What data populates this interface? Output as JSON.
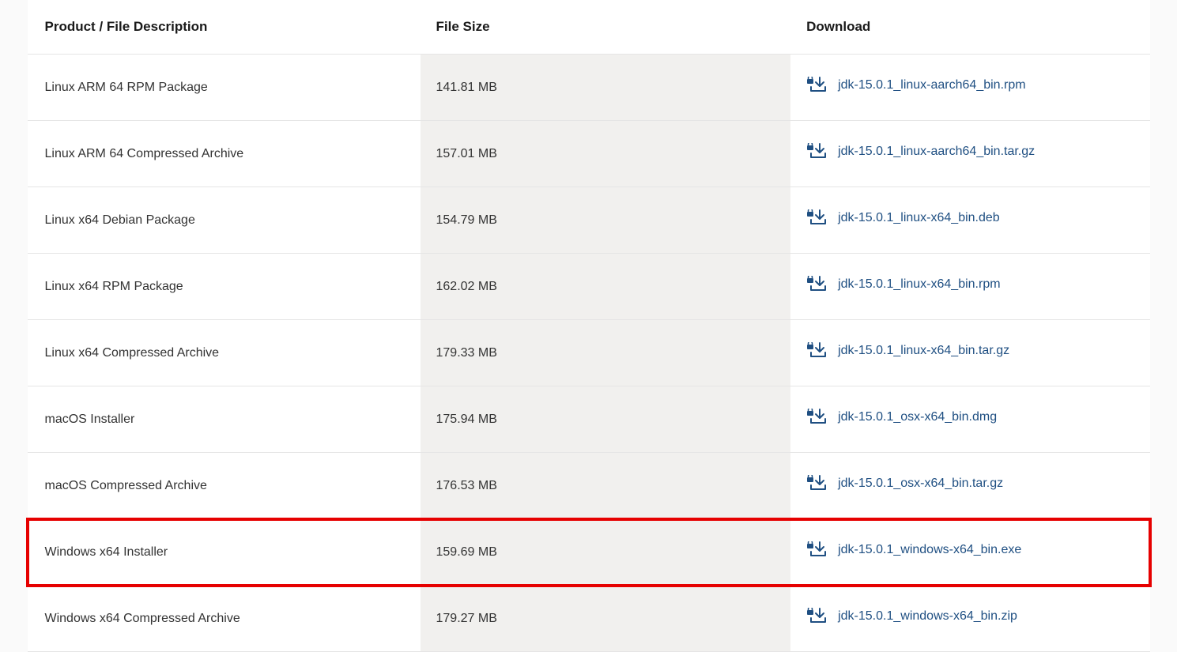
{
  "headers": {
    "product": "Product / File Description",
    "size": "File Size",
    "download": "Download"
  },
  "rows": [
    {
      "product": "Linux ARM 64 RPM Package",
      "size": "141.81 MB",
      "file": "jdk-15.0.1_linux-aarch64_bin.rpm",
      "highlighted": false
    },
    {
      "product": "Linux ARM 64 Compressed Archive",
      "size": "157.01 MB",
      "file": "jdk-15.0.1_linux-aarch64_bin.tar.gz",
      "highlighted": false
    },
    {
      "product": "Linux x64 Debian Package",
      "size": "154.79 MB",
      "file": "jdk-15.0.1_linux-x64_bin.deb",
      "highlighted": false
    },
    {
      "product": "Linux x64 RPM Package",
      "size": "162.02 MB",
      "file": "jdk-15.0.1_linux-x64_bin.rpm",
      "highlighted": false
    },
    {
      "product": "Linux x64 Compressed Archive",
      "size": "179.33 MB",
      "file": "jdk-15.0.1_linux-x64_bin.tar.gz",
      "highlighted": false
    },
    {
      "product": "macOS Installer",
      "size": "175.94 MB",
      "file": "jdk-15.0.1_osx-x64_bin.dmg",
      "highlighted": false
    },
    {
      "product": "macOS Compressed Archive",
      "size": "176.53 MB",
      "file": "jdk-15.0.1_osx-x64_bin.tar.gz",
      "highlighted": false
    },
    {
      "product": "Windows x64 Installer",
      "size": "159.69 MB",
      "file": "jdk-15.0.1_windows-x64_bin.exe",
      "highlighted": true
    },
    {
      "product": "Windows x64 Compressed Archive",
      "size": "179.27 MB",
      "file": "jdk-15.0.1_windows-x64_bin.zip",
      "highlighted": false
    }
  ],
  "colors": {
    "link": "#1f4f82",
    "highlight_border": "#e60000"
  }
}
